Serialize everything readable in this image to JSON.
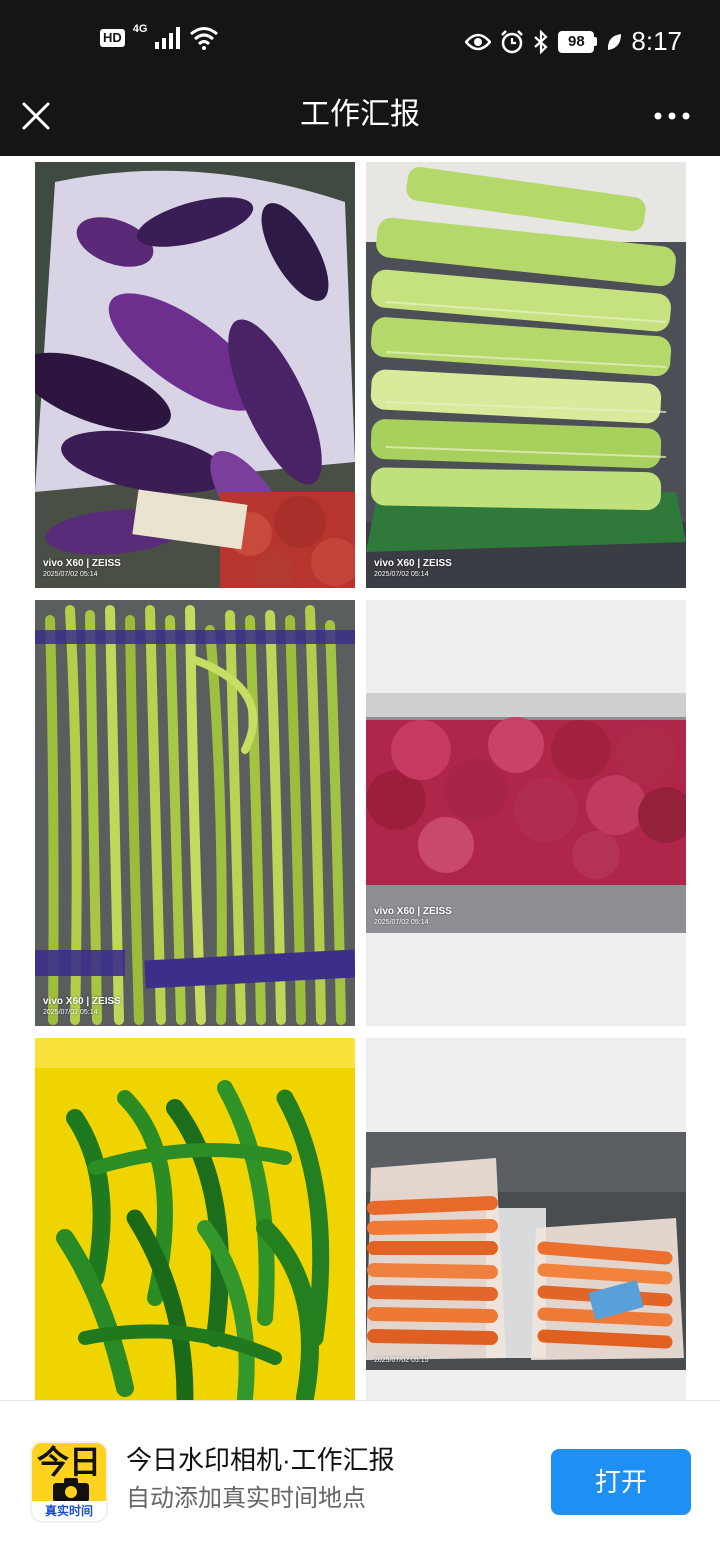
{
  "status_bar": {
    "hd_label": "HD",
    "network_label": "4G",
    "battery_level": "98",
    "time": "8:17",
    "icons": [
      "signal-icon",
      "wifi-icon",
      "eye-icon",
      "alarm-icon",
      "bluetooth-icon",
      "battery-icon",
      "leaf-icon"
    ]
  },
  "header": {
    "title": "工作汇报",
    "close_icon": "close-icon",
    "more_icon": "more-icon"
  },
  "photos": [
    {
      "subject": "eggplants",
      "camera": "vivo X60 | ZEISS",
      "date": "2025/07/02 05:14"
    },
    {
      "subject": "celery",
      "camera": "vivo X60 | ZEISS",
      "date": "2025/07/02 05:14"
    },
    {
      "subject": "garlic-scapes",
      "camera": "vivo X60 | ZEISS",
      "date": "2025/07/02 05:14"
    },
    {
      "subject": "red-onions",
      "camera": "vivo X60 | ZEISS",
      "date": "2025/07/02 05:14"
    },
    {
      "subject": "green-peppers",
      "camera": "",
      "date": ""
    },
    {
      "subject": "carrots",
      "camera": "",
      "date": "2025/07/02 05:15"
    }
  ],
  "ad": {
    "icon_text": "今日",
    "icon_caption": "真实时间",
    "title": "今日水印相机·工作汇报",
    "subtitle": "自动添加真实时间地点",
    "button_label": "打开"
  },
  "colors": {
    "status_bg": "#151515",
    "accent_blue": "#1e8ff5",
    "icon_yellow": "#ffd21f"
  }
}
